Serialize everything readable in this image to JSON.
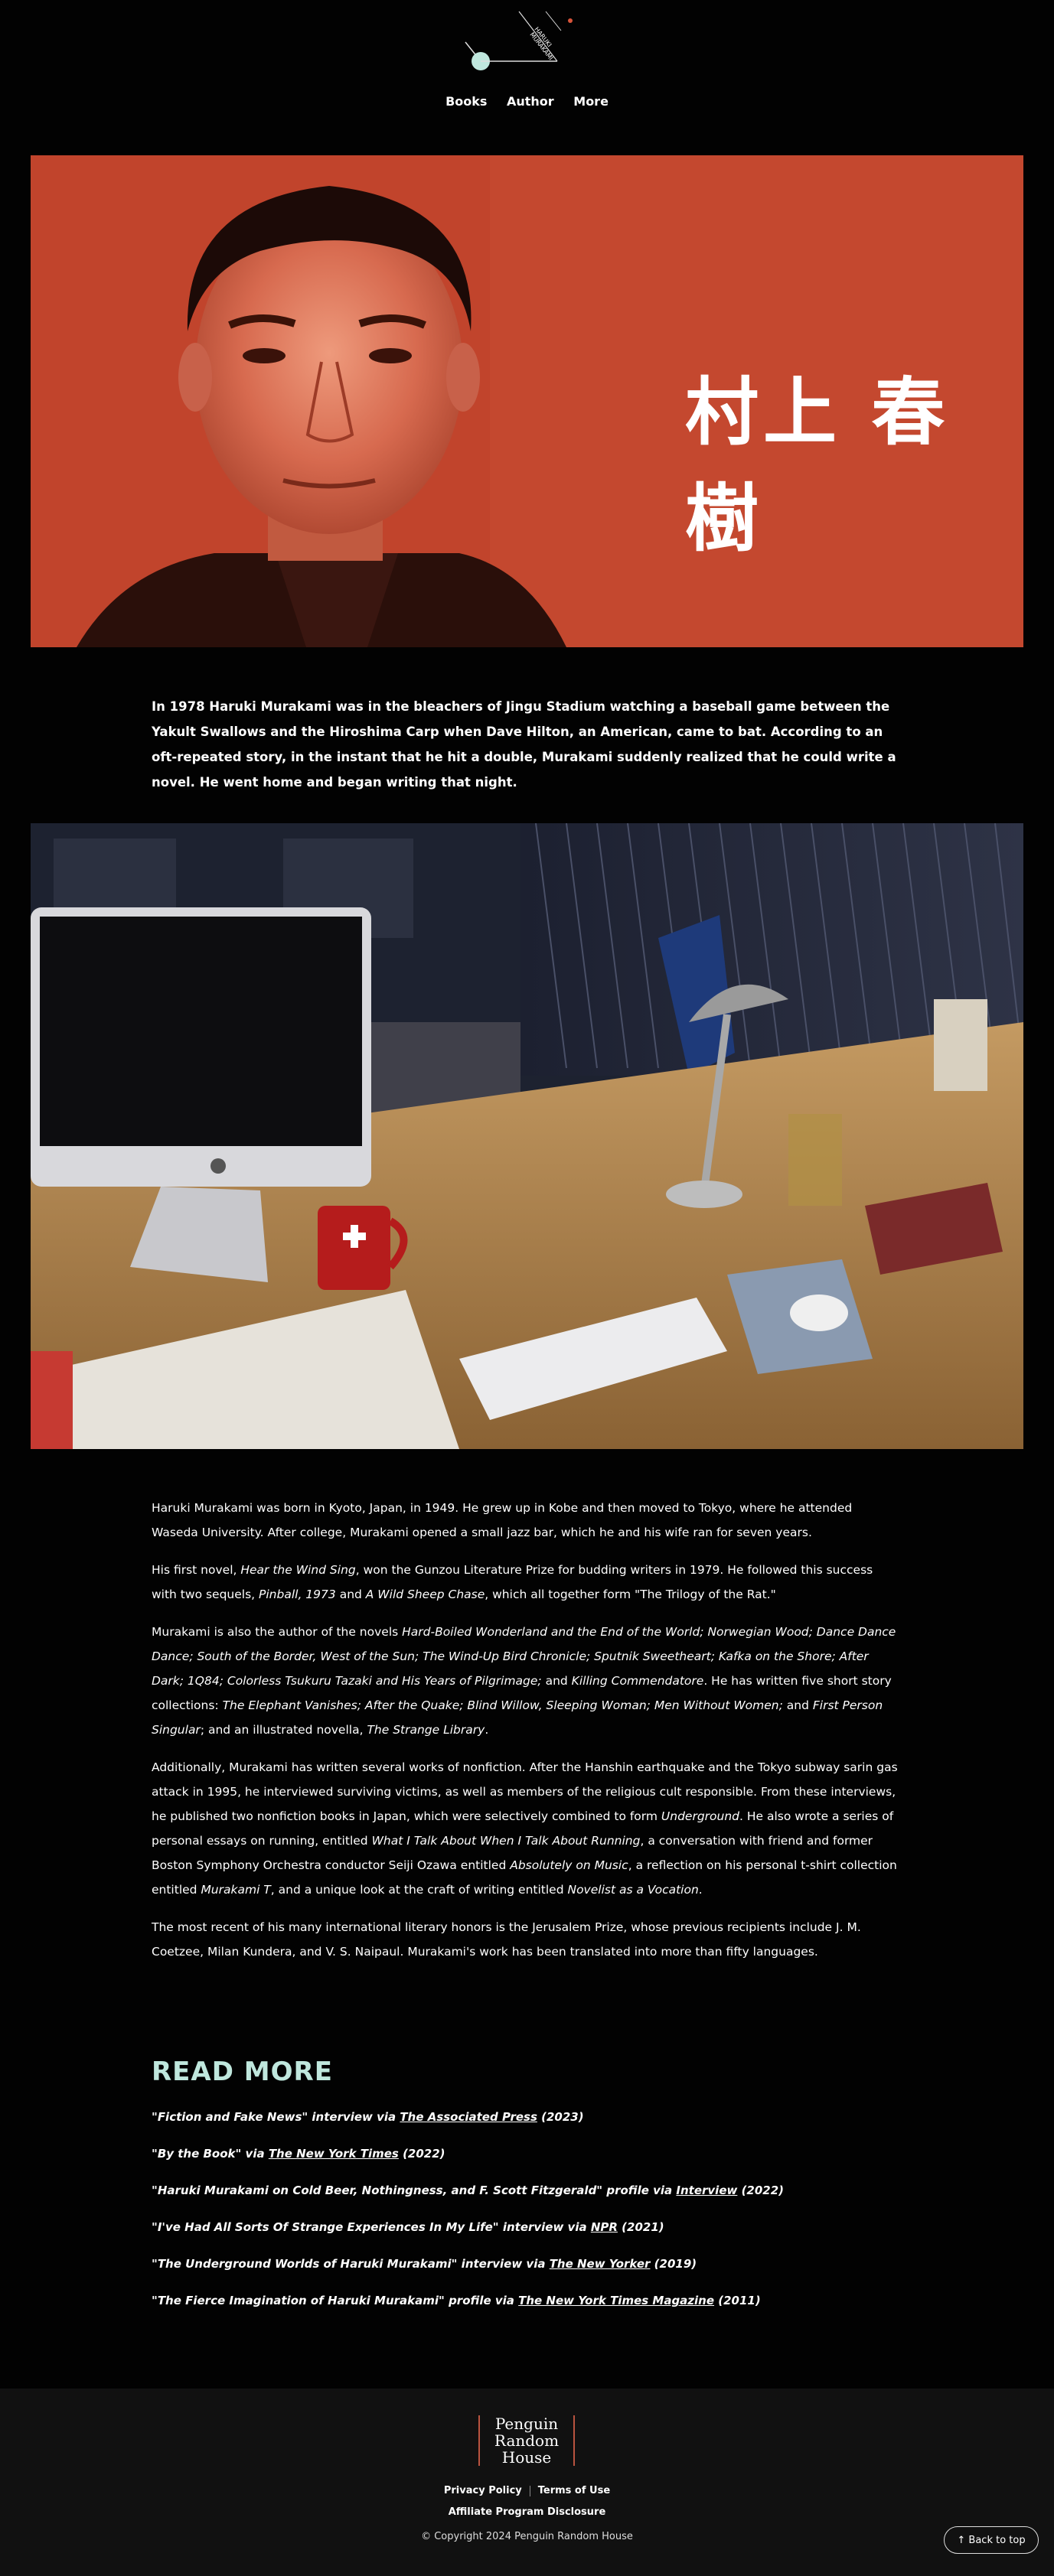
{
  "logo": {
    "text_line1": "HARUKI",
    "text_line2": "MURAKAMI"
  },
  "nav": {
    "items": [
      "Books",
      "Author",
      "More"
    ]
  },
  "hero": {
    "title": "村上 春樹"
  },
  "intro": "In 1978 Haruki Murakami was in the bleachers of Jingu Stadium watching a baseball game between the Yakult Swallows and the Hiroshima Carp when Dave Hilton, an American, came to bat. According to an oft-repeated story, in the instant that he hit a double, Murakami suddenly realized that he could write a novel. He went home and began writing that night.",
  "bio": {
    "p1": "Haruki Murakami was born in Kyoto, Japan, in 1949. He grew up in Kobe and then moved to Tokyo, where he attended Waseda University. After college, Murakami opened a small jazz bar, which he and his wife ran for seven years.",
    "p2": {
      "a": "His first novel, ",
      "b": "Hear the Wind Sing",
      "c": ", won the Gunzou Literature Prize for budding writers in 1979. He followed this success with two sequels, ",
      "d": "Pinball, 1973",
      "e": " and ",
      "f": "A Wild Sheep Chase",
      "g": ", which all together form \"The Trilogy of the Rat.\""
    },
    "p3": {
      "a": "Murakami is also the author of the novels ",
      "b": "Hard-Boiled Wonderland and the End of the World; Norwegian Wood; Dance Dance Dance; South of the Border, West of the Sun; The Wind-Up Bird Chronicle; Sputnik Sweetheart; Kafka on the Shore; After Dark; 1Q84; Colorless Tsukuru Tazaki and His Years of Pilgrimage;",
      "c": " and ",
      "d": "Killing Commendatore",
      "e": ". He has written five short story collections: ",
      "f": "The Elephant Vanishes; After the Quake; Blind Willow, Sleeping Woman; Men Without Women;",
      "g": " and ",
      "h": "First Person Singular",
      "i": "; and an illustrated novella, ",
      "j": "The Strange Library",
      "k": "."
    },
    "p4": {
      "a": "Additionally, Murakami has written several works of nonfiction. After the Hanshin earthquake and the Tokyo subway sarin gas attack in 1995, he interviewed surviving victims, as well as members of the religious cult responsible. From these interviews, he published two nonfiction books in Japan, which were selectively combined to form ",
      "b": "Underground",
      "c": ". He also wrote a series of personal essays on running, entitled ",
      "d": "What I Talk About When I Talk About Running",
      "e": ", a conversation with friend and former Boston Symphony Orchestra conductor Seiji Ozawa entitled ",
      "f": "Absolutely on Music",
      "g": ", a reflection on his personal t-shirt collection entitled ",
      "h": "Murakami T",
      "i": ", and a unique look at the craft of writing entitled ",
      "j": "Novelist as a Vocation",
      "k": "."
    },
    "p5": "The most recent of his many international literary honors is the Jerusalem Prize, whose previous recipients include J. M. Coetzee, Milan Kundera, and V. S. Naipaul. Murakami's work has been translated into more than fifty languages."
  },
  "read_more": {
    "title": "READ MORE",
    "items": [
      {
        "quote": "\"Fiction and Fake News\" interview via ",
        "source": "The Associated Press",
        "year": " (2023)"
      },
      {
        "quote": "\"By the Book\" via ",
        "source": "The New York Times",
        "year": " (2022)"
      },
      {
        "quote": "\"Haruki Murakami on Cold Beer, Nothingness, and F. Scott Fitzgerald\" profile via ",
        "source": "Interview",
        "year": " (2022)"
      },
      {
        "quote": "\"I've Had All Sorts Of Strange Experiences In My Life\" interview via ",
        "source": "NPR",
        "year": " (2021)"
      },
      {
        "quote": "\"The Underground Worlds of Haruki Murakami\" interview via ",
        "source": "The New Yorker",
        "year": " (2019)"
      },
      {
        "quote": "\"The Fierce Imagination of Haruki Murakami\" profile via ",
        "source": "The New York Times Magazine",
        "year": " (2011)"
      }
    ]
  },
  "footer": {
    "prh_line1": "Penguin",
    "prh_line2": "Random",
    "prh_line3": "House",
    "privacy": "Privacy Policy",
    "terms": "Terms of Use",
    "affiliate": "Affiliate Program Disclosure",
    "copyright": "© Copyright 2024 Penguin Random House",
    "back_to_top": "Back to top"
  },
  "colors": {
    "hero_red": "#c1442c",
    "accent_teal": "#bfe7dd",
    "prh_orange": "#b9533f"
  }
}
